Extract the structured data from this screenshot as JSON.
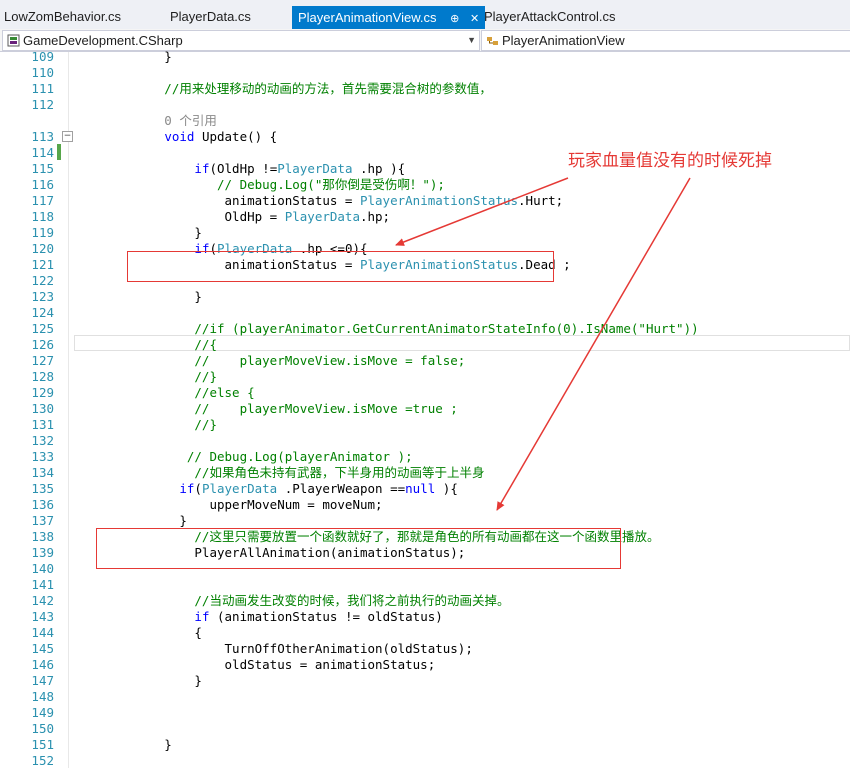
{
  "tabs": [
    {
      "label": "LowZomBehavior.cs",
      "active": false
    },
    {
      "label": "PlayerData.cs",
      "active": false
    },
    {
      "label": "PlayerAnimationView.cs",
      "active": true
    },
    {
      "label": "PlayerAttackControl.cs",
      "active": false
    }
  ],
  "tab_pin_glyph": "⊕",
  "tab_close_glyph": "✕",
  "navbar": {
    "project": "GameDevelopment.CSharp",
    "class": "PlayerAnimationView"
  },
  "code_lines": [
    {
      "n": "109",
      "parts": [
        [
          "p",
          "            }"
        ]
      ]
    },
    {
      "n": "110",
      "parts": []
    },
    {
      "n": "111",
      "parts": [
        [
          "cm",
          "            //用来处理移动的动画的方法，首先需要混合树的参数值，"
        ]
      ]
    },
    {
      "n": "112",
      "parts": []
    },
    {
      "n": "",
      "parts": [
        [
          "gr",
          "            0 个引用"
        ]
      ]
    },
    {
      "n": "113",
      "parts": [
        [
          "p",
          "            "
        ],
        [
          "kw",
          "void"
        ],
        [
          "p",
          " Update() {"
        ]
      ]
    },
    {
      "n": "114",
      "parts": []
    },
    {
      "n": "115",
      "parts": [
        [
          "p",
          "                "
        ],
        [
          "kw",
          "if"
        ],
        [
          "p",
          "(OldHp !="
        ],
        [
          "ty",
          "PlayerData"
        ],
        [
          "p",
          " .hp ){"
        ]
      ]
    },
    {
      "n": "116",
      "parts": [
        [
          "cm",
          "                   // Debug.Log(\"那你倒是受伤啊！\");"
        ]
      ]
    },
    {
      "n": "117",
      "parts": [
        [
          "p",
          "                    animationStatus = "
        ],
        [
          "ty",
          "PlayerAnimationStatus"
        ],
        [
          "p",
          ".Hurt;"
        ]
      ]
    },
    {
      "n": "118",
      "parts": [
        [
          "p",
          "                    OldHp = "
        ],
        [
          "ty",
          "PlayerData"
        ],
        [
          "p",
          ".hp;"
        ]
      ]
    },
    {
      "n": "119",
      "parts": [
        [
          "p",
          "                }"
        ]
      ]
    },
    {
      "n": "120",
      "parts": [
        [
          "p",
          "                "
        ],
        [
          "kw",
          "if"
        ],
        [
          "p",
          "("
        ],
        [
          "ty",
          "PlayerData"
        ],
        [
          "p",
          " .hp <=0){"
        ]
      ]
    },
    {
      "n": "121",
      "parts": [
        [
          "p",
          "                    animationStatus = "
        ],
        [
          "ty",
          "PlayerAnimationStatus"
        ],
        [
          "p",
          ".Dead ;"
        ]
      ]
    },
    {
      "n": "122",
      "parts": []
    },
    {
      "n": "123",
      "parts": [
        [
          "p",
          "                }"
        ]
      ]
    },
    {
      "n": "124",
      "parts": []
    },
    {
      "n": "125",
      "parts": [
        [
          "cm",
          "                //if (playerAnimator.GetCurrentAnimatorStateInfo(0).IsName(\"Hurt\"))"
        ]
      ]
    },
    {
      "n": "126",
      "parts": [
        [
          "cm",
          "                //{"
        ]
      ]
    },
    {
      "n": "127",
      "parts": [
        [
          "cm",
          "                //    playerMoveView.isMove = false;"
        ]
      ]
    },
    {
      "n": "128",
      "parts": [
        [
          "cm",
          "                //}"
        ]
      ]
    },
    {
      "n": "129",
      "parts": [
        [
          "cm",
          "                //else {"
        ]
      ]
    },
    {
      "n": "130",
      "parts": [
        [
          "cm",
          "                //    playerMoveView.isMove =true ;"
        ]
      ]
    },
    {
      "n": "131",
      "parts": [
        [
          "cm",
          "                //}"
        ]
      ]
    },
    {
      "n": "132",
      "parts": []
    },
    {
      "n": "133",
      "parts": [
        [
          "cm",
          "               // Debug.Log(playerAnimator );"
        ]
      ]
    },
    {
      "n": "134",
      "parts": [
        [
          "cm",
          "                //如果角色未持有武器，下半身用的动画等于上半身"
        ]
      ]
    },
    {
      "n": "135",
      "parts": [
        [
          "p",
          "              "
        ],
        [
          "kw",
          "if"
        ],
        [
          "p",
          "("
        ],
        [
          "ty",
          "PlayerData"
        ],
        [
          "p",
          " .PlayerWeapon =="
        ],
        [
          "kw",
          "null"
        ],
        [
          "p",
          " ){"
        ]
      ]
    },
    {
      "n": "136",
      "parts": [
        [
          "p",
          "                  upperMoveNum = moveNum;"
        ]
      ]
    },
    {
      "n": "137",
      "parts": [
        [
          "p",
          "              }"
        ]
      ]
    },
    {
      "n": "138",
      "parts": [
        [
          "cm",
          "                //这里只需要放置一个函数就好了，那就是角色的所有动画都在这一个函数里播放。"
        ]
      ]
    },
    {
      "n": "139",
      "parts": [
        [
          "p",
          "                PlayerAllAnimation(animationStatus);"
        ]
      ]
    },
    {
      "n": "140",
      "parts": []
    },
    {
      "n": "141",
      "parts": []
    },
    {
      "n": "142",
      "parts": [
        [
          "cm",
          "                //当动画发生改变的时候，我们将之前执行的动画关掉。"
        ]
      ]
    },
    {
      "n": "143",
      "parts": [
        [
          "p",
          "                "
        ],
        [
          "kw",
          "if"
        ],
        [
          "p",
          " (animationStatus != oldStatus)"
        ]
      ]
    },
    {
      "n": "144",
      "parts": [
        [
          "p",
          "                {"
        ]
      ]
    },
    {
      "n": "145",
      "parts": [
        [
          "p",
          "                    TurnOffOtherAnimation(oldStatus);"
        ]
      ]
    },
    {
      "n": "146",
      "parts": [
        [
          "p",
          "                    oldStatus = animationStatus;"
        ]
      ]
    },
    {
      "n": "147",
      "parts": [
        [
          "p",
          "                }"
        ]
      ]
    },
    {
      "n": "148",
      "parts": []
    },
    {
      "n": "149",
      "parts": []
    },
    {
      "n": "150",
      "parts": []
    },
    {
      "n": "151",
      "parts": [
        [
          "p",
          "            }"
        ]
      ]
    },
    {
      "n": "152",
      "parts": []
    }
  ],
  "annotation": {
    "text": "玩家血量值没有的时候死掉",
    "color": "#e53935"
  },
  "colors": {
    "keyword": "#0000ff",
    "type": "#2b91af",
    "comment": "#008000",
    "line_number": "#2b91af",
    "active_tab": "#007acc"
  }
}
